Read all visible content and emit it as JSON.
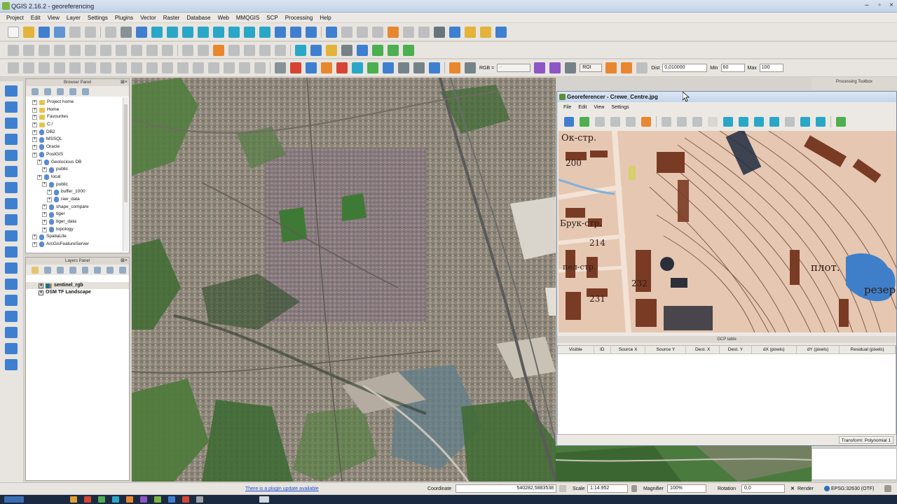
{
  "app": {
    "title": "QGIS 2.16.2 - georeferencing"
  },
  "menu": [
    "Project",
    "Edit",
    "View",
    "Layer",
    "Settings",
    "Plugins",
    "Vector",
    "Raster",
    "Database",
    "Web",
    "MMQGIS",
    "SCP",
    "Processing",
    "Help"
  ],
  "toolbar_scp": {
    "rgb_label": "RGB =",
    "rgb_value": "-",
    "roi_label": "ROI",
    "dist_label": "Dist",
    "dist_value": "0,010000",
    "min_label": "Min",
    "min_value": "60",
    "max_label": "Max",
    "max_value": "100"
  },
  "browser_panel": {
    "title": "Browser Panel",
    "items": [
      {
        "label": "Project home",
        "indent": 1,
        "kind": "folder"
      },
      {
        "label": "Home",
        "indent": 1,
        "kind": "folder"
      },
      {
        "label": "Favourites",
        "indent": 1,
        "kind": "folder"
      },
      {
        "label": "C:/",
        "indent": 1,
        "kind": "folder"
      },
      {
        "label": "DB2",
        "indent": 1,
        "kind": "db"
      },
      {
        "label": "MSSQL",
        "indent": 1,
        "kind": "db"
      },
      {
        "label": "Oracle",
        "indent": 1,
        "kind": "db"
      },
      {
        "label": "PostGIS",
        "indent": 1,
        "kind": "db"
      },
      {
        "label": "Geolocious DB",
        "indent": 2,
        "kind": "db"
      },
      {
        "label": "public",
        "indent": 3,
        "kind": "db"
      },
      {
        "label": "local",
        "indent": 2,
        "kind": "db"
      },
      {
        "label": "public",
        "indent": 3,
        "kind": "db"
      },
      {
        "label": "buffer_1000",
        "indent": 4,
        "kind": "db"
      },
      {
        "label": "raw_data",
        "indent": 4,
        "kind": "db"
      },
      {
        "label": "shape_compare",
        "indent": 3,
        "kind": "db"
      },
      {
        "label": "tiger",
        "indent": 3,
        "kind": "db"
      },
      {
        "label": "tiger_data",
        "indent": 3,
        "kind": "db"
      },
      {
        "label": "topology",
        "indent": 3,
        "kind": "db"
      },
      {
        "label": "SpatiaLite",
        "indent": 1,
        "kind": "db"
      },
      {
        "label": "ArcGisFeatureServer",
        "indent": 1,
        "kind": "db"
      }
    ]
  },
  "layers_panel": {
    "title": "Layers Panel",
    "layers": [
      {
        "label": "sentinel_rgb",
        "checked": "x"
      },
      {
        "label": "OSM TF Landscape",
        "checked": "x"
      }
    ]
  },
  "processing_toolbox": {
    "title": "Processing Toolbox"
  },
  "georeferencer": {
    "title": "Georeferencer - Crewe_Centre.jpg",
    "menu": [
      "File",
      "Edit",
      "View",
      "Settings"
    ],
    "gcp_table_title": "GCP table",
    "gcp_columns": [
      "Visible",
      "ID",
      "Source X",
      "Source Y",
      "Dest. X",
      "Dest. Y",
      "dX (pixels)",
      "dY (pixels)",
      "Residual (pixels)"
    ],
    "transform_status": "Transform: Polynomial 1",
    "map_labels": [
      "Ок-стр.",
      "200",
      "Брук-стр.",
      "214",
      "пел-стр.",
      "232",
      "231",
      "плот.",
      "резер"
    ]
  },
  "statusbar": {
    "plugin_update": "There is a plugin update available",
    "coordinate_label": "Coordinate",
    "coordinate_value": "540282,5883538",
    "scale_label": "Scale",
    "scale_value": "1:14.952",
    "magnifier_label": "Magnifier",
    "magnifier_value": "100%",
    "rotation_label": "Rotation",
    "rotation_value": "0,0",
    "render_label": "Render",
    "crs_label": "EPSG:32630 (OTF)"
  }
}
